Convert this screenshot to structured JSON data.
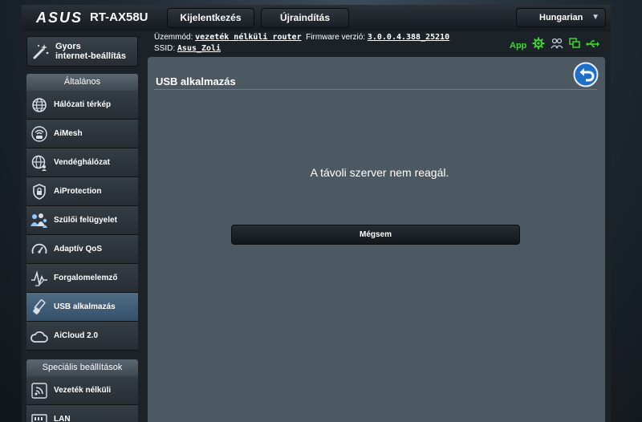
{
  "header": {
    "brand": "ASUS",
    "model": "RT-AX58U",
    "logout_label": "Kijelentkezés",
    "reboot_label": "Újraindítás",
    "language": "Hungarian"
  },
  "status": {
    "mode_label": "Üzemmód:",
    "mode_value": "vezeték nélküli router",
    "firmware_label": "Firmware verzió:",
    "firmware_value": "3.0.0.4.388_25210",
    "ssid_label": "SSID:",
    "ssid_value": "Asus_Zoli",
    "app_label": "App",
    "colors": {
      "app": "#3cd82b"
    }
  },
  "sidebar": {
    "quick_setup": {
      "line1": "Gyors",
      "line2": "internet-beállítás"
    },
    "general_title": "Általános",
    "general_items": [
      {
        "label": "Hálózati térkép",
        "icon": "globe-network-icon"
      },
      {
        "label": "AiMesh",
        "icon": "aimesh-icon"
      },
      {
        "label": "Vendéghálózat",
        "icon": "guest-network-icon"
      },
      {
        "label": "AiProtection",
        "icon": "shield-lock-icon"
      },
      {
        "label": "Szülői felügyelet",
        "icon": "family-icon"
      },
      {
        "label": "Adaptív QoS",
        "icon": "speedometer-icon"
      },
      {
        "label": "Forgalomelemző",
        "icon": "traffic-analyzer-icon"
      },
      {
        "label": "USB alkalmazás",
        "icon": "usb-icon",
        "active": true
      },
      {
        "label": "AiCloud 2.0",
        "icon": "cloud-icon"
      }
    ],
    "advanced_title": "Speciális beállítások",
    "advanced_items": [
      {
        "label": "Vezeték nélküli",
        "icon": "wifi-icon"
      },
      {
        "label": "LAN",
        "icon": "lan-icon"
      }
    ]
  },
  "main": {
    "title": "USB alkalmazás",
    "message": "A távoli szerver nem reagál.",
    "cancel_label": "Mégsem"
  }
}
